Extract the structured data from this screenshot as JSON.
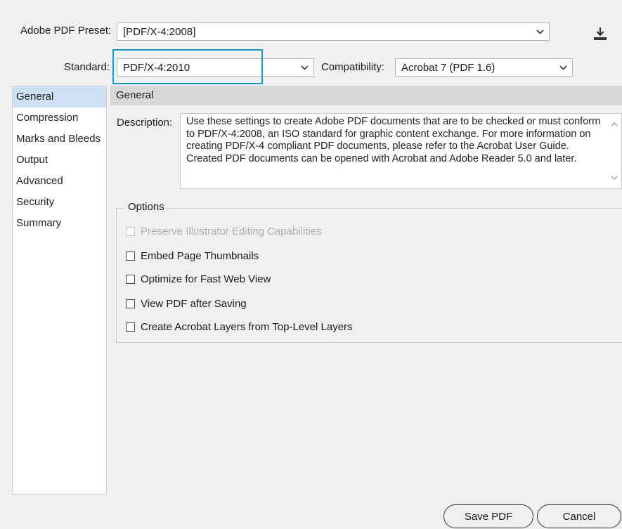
{
  "preset": {
    "label": "Adobe PDF Preset:",
    "value": "[PDF/X-4:2008]"
  },
  "standard": {
    "label": "Standard:",
    "value": "PDF/X-4:2010"
  },
  "compatibility": {
    "label": "Compatibility:",
    "value": "Acrobat 7 (PDF 1.6)"
  },
  "sidebar": {
    "items": [
      {
        "label": "General"
      },
      {
        "label": "Compression"
      },
      {
        "label": "Marks and Bleeds"
      },
      {
        "label": "Output"
      },
      {
        "label": "Advanced"
      },
      {
        "label": "Security"
      },
      {
        "label": "Summary"
      }
    ]
  },
  "section": {
    "title": "General"
  },
  "description": {
    "label": "Description:",
    "text": "Use these settings to create Adobe PDF documents that are to be checked or must conform to PDF/X-4:2008, an ISO standard for graphic content exchange.  For more information on creating PDF/X-4 compliant PDF documents, please refer to the Acrobat User Guide.  Created PDF documents can be opened with Acrobat and Adobe Reader 5.0 and later."
  },
  "options": {
    "title": "Options",
    "items": [
      {
        "label": "Preserve Illustrator Editing Capabilities",
        "disabled": true
      },
      {
        "label": "Embed Page Thumbnails"
      },
      {
        "label": "Optimize for Fast Web View"
      },
      {
        "label": "View PDF after Saving"
      },
      {
        "label": "Create Acrobat Layers from Top-Level Layers"
      }
    ]
  },
  "buttons": {
    "save": "Save PDF",
    "cancel": "Cancel"
  },
  "colors": {
    "highlight": "#1a9bd0",
    "sidebar_selected": "#cde0f5"
  },
  "icons": {
    "save_preset": "download-icon",
    "dropdown": "chevron-down-icon"
  }
}
